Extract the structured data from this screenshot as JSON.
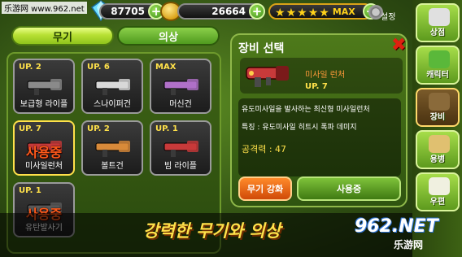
{
  "watermark": "乐游网 www.962.net",
  "topbar": {
    "gems": "87705",
    "coins": "26664",
    "star_count": 5,
    "star_label": "MAX",
    "settings_label": "설정"
  },
  "tabs": {
    "weapon": "무기",
    "costume": "의상"
  },
  "weapons": [
    {
      "level": "UP. 2",
      "name": "보급형 라이플",
      "in_use": "",
      "color": "#8a8a8a"
    },
    {
      "level": "UP. 6",
      "name": "스나이퍼건",
      "in_use": "",
      "color": "#d8d8d8"
    },
    {
      "level": "MAX",
      "name": "머신건",
      "in_use": "",
      "color": "#b070c8"
    },
    {
      "level": "UP. 7",
      "name": "미사일런처",
      "in_use": "사용중",
      "color": "#c83a3a"
    },
    {
      "level": "UP. 2",
      "name": "볼트건",
      "in_use": "",
      "color": "#d88a3a"
    },
    {
      "level": "UP. 1",
      "name": "빔 라이플",
      "in_use": "",
      "color": "#c83a3a"
    },
    {
      "level": "UP. 1",
      "name": "유탄발사기",
      "in_use": "사용중",
      "color": "#5a5a5a"
    }
  ],
  "equip_panel": {
    "title": "장비 선택",
    "item_name": "미사일 런처",
    "item_level": "UP. 7",
    "description": "유도미사일을 발사하는 최신형 미사일런처",
    "feature": "특징 : 유도미사일 히트시 폭파 데미지",
    "attack": "공격력 : 47",
    "upgrade_button": "무기 강화",
    "inuse_button": "사용중"
  },
  "sidebar": [
    {
      "label": "상점",
      "icon": "shop-icon",
      "color": "#e0e0e0"
    },
    {
      "label": "캐릭터",
      "icon": "character-icon",
      "color": "#5ab83a"
    },
    {
      "label": "장비",
      "icon": "equipment-icon",
      "color": "#8a6a3a"
    },
    {
      "label": "용병",
      "icon": "mercenary-icon",
      "color": "#e0c070"
    },
    {
      "label": "우편",
      "icon": "mail-icon",
      "color": "#f0f0e0"
    }
  ],
  "banner": {
    "text": "강력한 무기와 의상",
    "logo": "962.NET",
    "logo_sub": "乐游网"
  }
}
